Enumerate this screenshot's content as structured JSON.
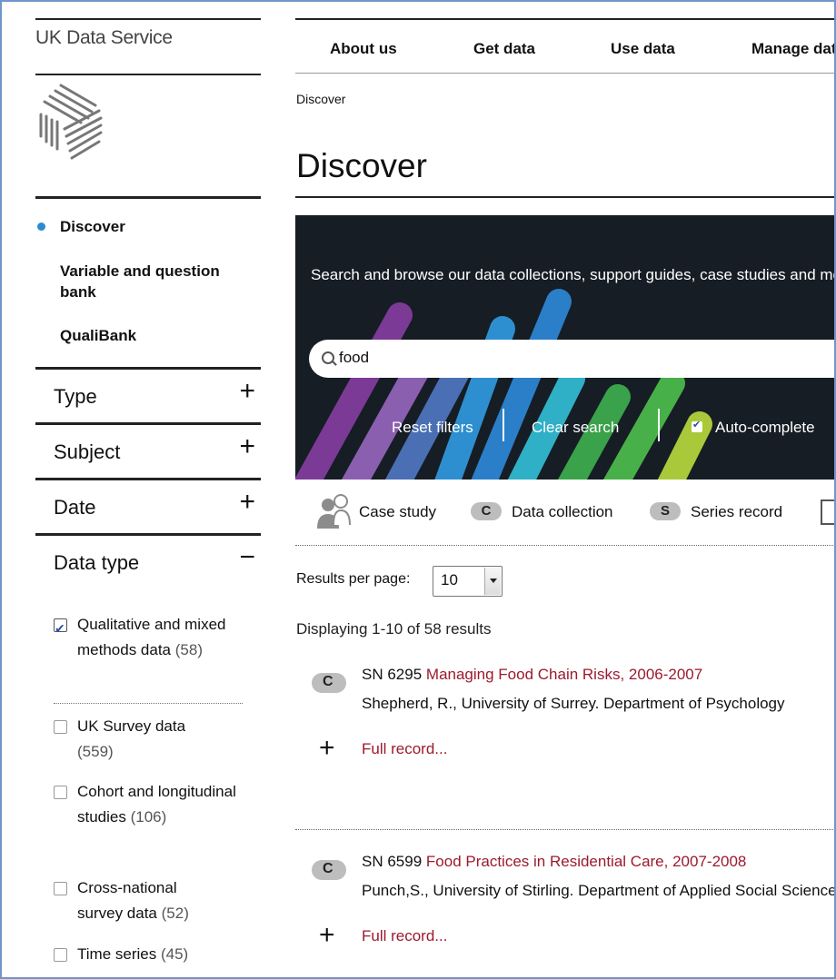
{
  "brand": {
    "name": "UK Data Service",
    "logo_icon": "ukds-logo-icon"
  },
  "sidebar": {
    "nav": [
      {
        "label": "Discover",
        "active": true
      },
      {
        "label": "Variable and question bank",
        "active": false
      },
      {
        "label": "QualiBank",
        "active": false
      }
    ],
    "facets": [
      {
        "label": "Type",
        "toggle": "+"
      },
      {
        "label": "Subject",
        "toggle": "+"
      },
      {
        "label": "Date",
        "toggle": "+"
      },
      {
        "label": "Data type",
        "toggle": "−"
      }
    ],
    "data_type_options": [
      {
        "label": "Qualitative and mixed methods data",
        "count": "(58)",
        "checked": true
      },
      {
        "label": "UK Survey data",
        "count": "(559)",
        "checked": false
      },
      {
        "label": "Cohort and longitudinal studies",
        "count": "(106)",
        "checked": false
      },
      {
        "label": "Cross-national survey data",
        "count": "(52)",
        "checked": false
      },
      {
        "label": "Time series",
        "count": "(45)",
        "checked": false
      }
    ]
  },
  "topnav": [
    "About us",
    "Get data",
    "Use data",
    "Manage data"
  ],
  "breadcrumb": "Discover",
  "page_title": "Discover",
  "hero": {
    "text": "Search and browse our data collections, support guides, case studies and more",
    "search_value": "food",
    "reset_filters": "Reset filters",
    "clear_search": "Clear search",
    "auto_complete": "Auto-complete",
    "auto_complete_checked": true
  },
  "legend": [
    {
      "icon": "case-study-icon",
      "label": "Case study"
    },
    {
      "icon": "data-collection-icon",
      "badge": "C",
      "label": "Data collection"
    },
    {
      "icon": "series-record-icon",
      "badge": "S",
      "label": "Series record"
    }
  ],
  "results_per_page": {
    "label": "Results per page:",
    "value": "10"
  },
  "displaying": "Displaying 1-10 of 58 results",
  "results": [
    {
      "badge": "C",
      "sn": "SN 6295",
      "title": "Managing Food Chain Risks, 2006-2007",
      "author": "Shepherd, R., University of Surrey. Department of Psychology",
      "full_record": "Full record..."
    },
    {
      "badge": "C",
      "sn": "SN 6599",
      "title": "Food Practices in Residential Care, 2007-2008",
      "author": "Punch,S., University of Stirling. Department of Applied Social Science",
      "full_record": "Full record..."
    }
  ],
  "colors": {
    "link": "#9c1a2d",
    "hero_bg": "#161d24",
    "active_dot": "#2a8bd0",
    "frame": "#6f96c9"
  }
}
